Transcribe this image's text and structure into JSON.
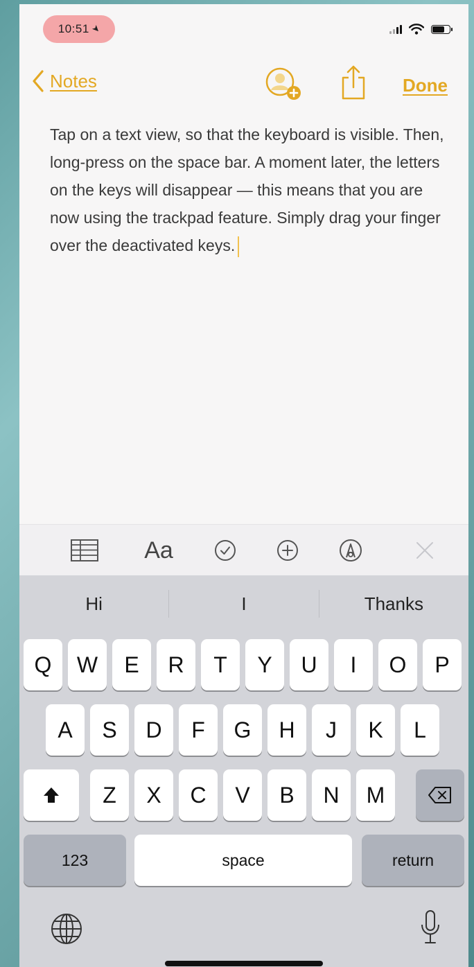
{
  "status_bar": {
    "time": "10:51",
    "location_glyph": "➤",
    "icons": [
      "signal-icon",
      "wifi-icon",
      "battery-icon"
    ]
  },
  "nav": {
    "back_label": "Notes",
    "done_label": "Done",
    "accent_color": "#e3a823"
  },
  "note": {
    "text": "Tap on a text view, so that the keyboard is visible. Then, long-press on the space bar. A moment later, the letters on the keys will disappear — this means that you are now using the trackpad feature. Simply drag your finger over the deactivated keys."
  },
  "toolbar": {
    "text_style_label": "Aa",
    "icons": [
      "table-icon",
      "text-style-icon",
      "checklist-icon",
      "add-icon",
      "markup-icon",
      "close-icon"
    ]
  },
  "keyboard": {
    "predictions": [
      "Hi",
      "I",
      "Thanks"
    ],
    "row1": [
      "Q",
      "W",
      "E",
      "R",
      "T",
      "Y",
      "U",
      "I",
      "O",
      "P"
    ],
    "row2": [
      "A",
      "S",
      "D",
      "F",
      "G",
      "H",
      "J",
      "K",
      "L"
    ],
    "row3": [
      "Z",
      "X",
      "C",
      "V",
      "B",
      "N",
      "M"
    ],
    "numbers_label": "123",
    "space_label": "space",
    "return_label": "return"
  }
}
